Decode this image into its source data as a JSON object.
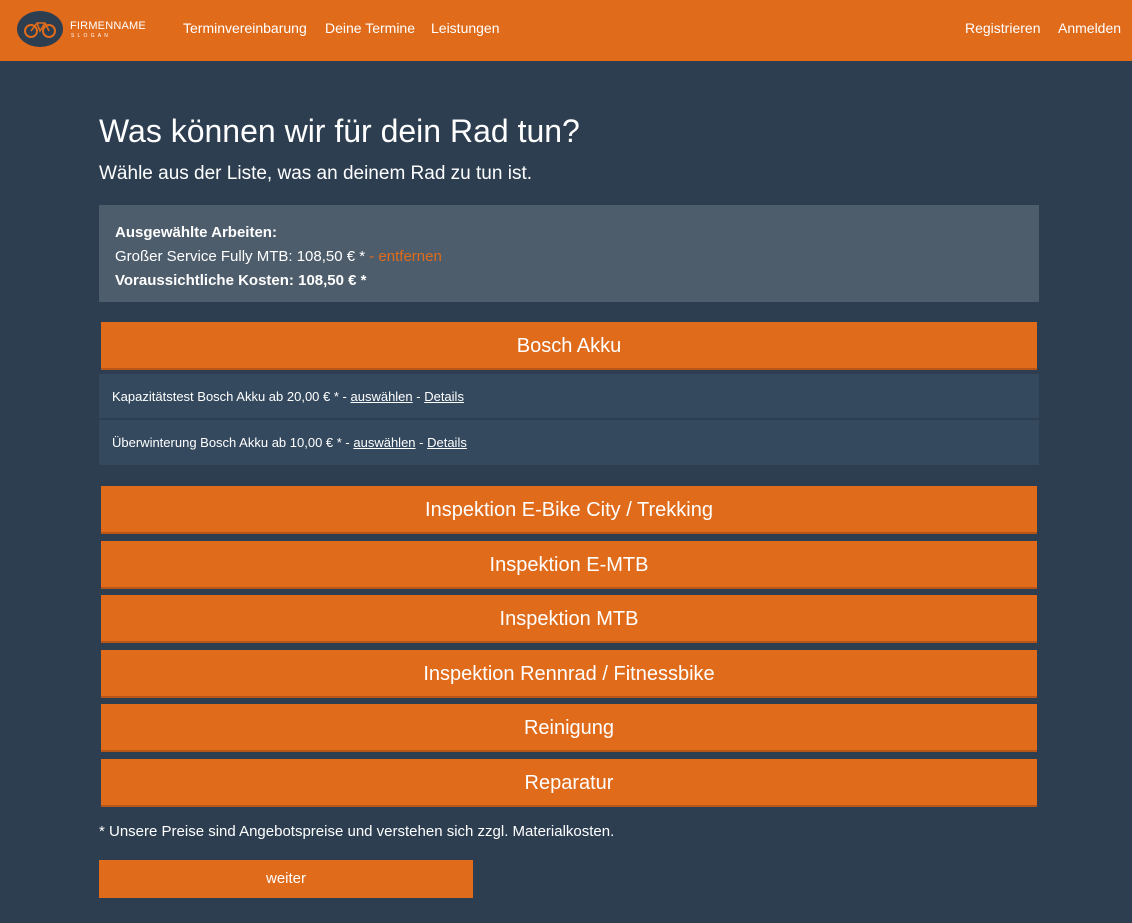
{
  "brand": {
    "name": "FIRMENNAME",
    "slogan": "SLOGAN"
  },
  "nav": {
    "left": [
      "Terminvereinbarung",
      "Deine Termine",
      "Leistungen"
    ],
    "right": [
      "Registrieren",
      "Anmelden"
    ]
  },
  "page": {
    "title": "Was können wir für dein Rad tun?",
    "subtitle": "Wähle aus der Liste, was an deinem Rad zu tun ist."
  },
  "summary": {
    "heading": "Ausgewählte Arbeiten:",
    "item": "Großer Service Fully MTB: 108,50 € *",
    "remove_label": "- entfernen",
    "total": "Voraussichtliche Kosten: 108,50 € *"
  },
  "categories": [
    {
      "label": "Bosch Akku",
      "expanded": true,
      "services": [
        {
          "text": "Kapazitätstest Bosch Akku ab 20,00 € * - ",
          "select": "auswählen",
          "sep": " - ",
          "details": "Details"
        },
        {
          "text": "Überwinterung Bosch Akku ab 10,00 € * - ",
          "select": "auswählen",
          "sep": " - ",
          "details": "Details"
        }
      ]
    },
    {
      "label": "Inspektion E-Bike City / Trekking"
    },
    {
      "label": "Inspektion E-MTB"
    },
    {
      "label": "Inspektion MTB"
    },
    {
      "label": "Inspektion Rennrad / Fitnessbike"
    },
    {
      "label": "Reinigung"
    },
    {
      "label": "Reparatur"
    }
  ],
  "note": "* Unsere Preise sind Angebotspreise und verstehen sich zzgl. Materialkosten.",
  "weiter_label": "weiter",
  "colors": {
    "accent": "#e06b1b",
    "background": "#2c3e50",
    "panel": "#4e5d6c",
    "row": "#34495e"
  }
}
